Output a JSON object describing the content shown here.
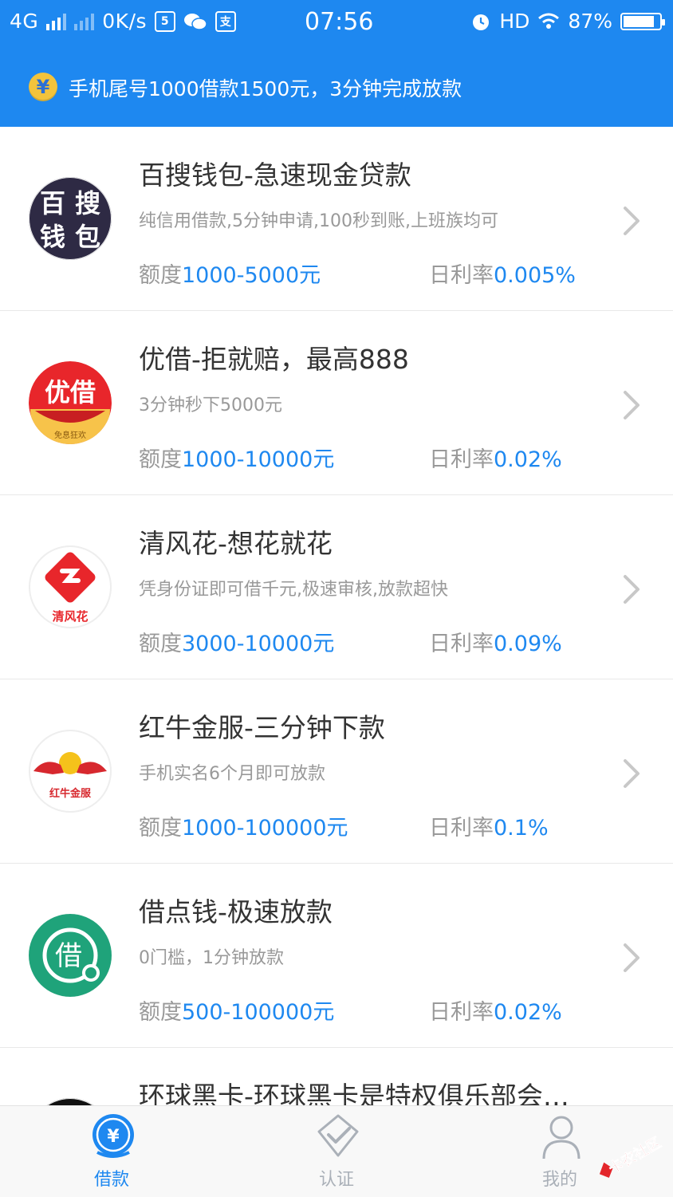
{
  "status_bar": {
    "network": "4G",
    "speed": "0K/s",
    "time": "07:56",
    "hd": "HD",
    "battery": "87%"
  },
  "notice": {
    "icon": "yuan-coin-icon",
    "text": "手机尾号1000借款1500元，3分钟完成放款"
  },
  "items": [
    {
      "title": "百搜钱包-急速现金贷款",
      "desc": "纯信用借款,5分钟申请,100秒到账,上班族均可",
      "quota_label": "额度",
      "quota_value": "1000-5000元",
      "rate_label": "日利率",
      "rate_value": "0.005%",
      "logo_text": [
        "百",
        "搜",
        "钱",
        "包"
      ]
    },
    {
      "title": "优借-拒就赔，最高888",
      "desc": "3分钟秒下5000元",
      "quota_label": "额度",
      "quota_value": "1000-10000元",
      "rate_label": "日利率",
      "rate_value": "0.02%",
      "logo_text": [
        "优借",
        "免息狂欢"
      ]
    },
    {
      "title": "清风花-想花就花",
      "desc": "凭身份证即可借千元,极速审核,放款超快",
      "quota_label": "额度",
      "quota_value": "3000-10000元",
      "rate_label": "日利率",
      "rate_value": "0.09%",
      "logo_text": [
        "清风花"
      ]
    },
    {
      "title": "红牛金服-三分钟下款",
      "desc": "手机实名6个月即可放款",
      "quota_label": "额度",
      "quota_value": "1000-100000元",
      "rate_label": "日利率",
      "rate_value": "0.1%",
      "logo_text": [
        "红牛金服"
      ]
    },
    {
      "title": "借点钱-极速放款",
      "desc": "0门槛，1分钟放款",
      "quota_label": "额度",
      "quota_value": "500-100000元",
      "rate_label": "日利率",
      "rate_value": "0.02%",
      "logo_text": [
        "借"
      ]
    },
    {
      "title": "环球黑卡-环球黑卡是特权俱乐部会…"
    }
  ],
  "tabs": [
    {
      "label": "借款",
      "icon": "yuan-badge-icon",
      "active": true
    },
    {
      "label": "认证",
      "icon": "shield-check-icon",
      "active": false
    },
    {
      "label": "我的",
      "icon": "user-icon",
      "active": false
    }
  ],
  "watermark": {
    "text": "卡农社区"
  },
  "colors": {
    "primary": "#1E88F0",
    "muted": "#999999",
    "coin": "#F2C33C"
  }
}
